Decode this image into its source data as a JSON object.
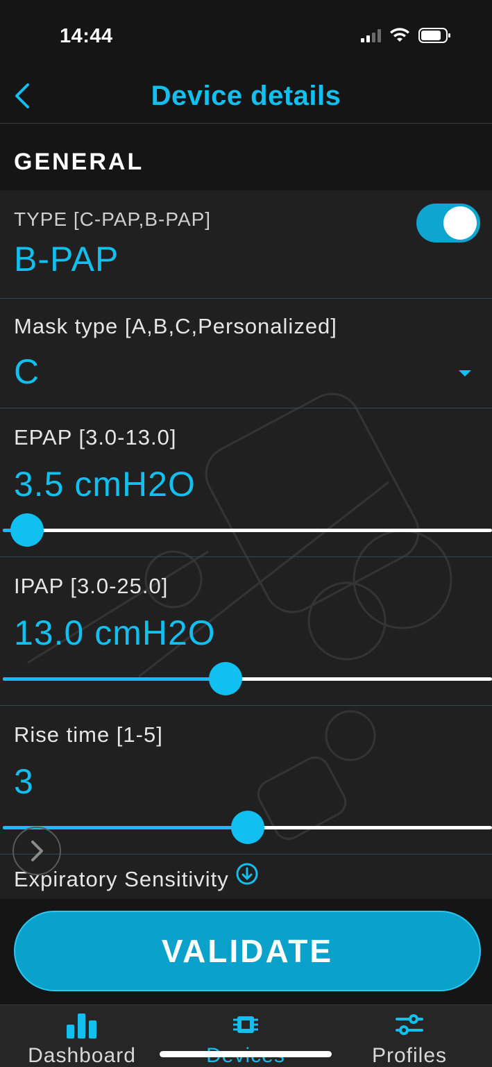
{
  "status": {
    "time": "14:44"
  },
  "header": {
    "title": "Device details"
  },
  "section": {
    "title": "GENERAL"
  },
  "fields": {
    "type": {
      "label": "TYPE [C-PAP,B-PAP]",
      "value": "B-PAP",
      "toggle_on": true
    },
    "mask": {
      "label": "Mask type [A,B,C,Personalized]",
      "value": "C"
    },
    "epap": {
      "label": "EPAP [3.0-13.0]",
      "value": "3.5 cmH2O",
      "slider_fraction": 0.05
    },
    "ipap": {
      "label": "IPAP [3.0-25.0]",
      "value": "13.0 cmH2O",
      "slider_fraction": 0.455
    },
    "rise_time": {
      "label": "Rise time [1-5]",
      "value": "3",
      "slider_fraction": 0.5
    },
    "expiratory": {
      "label": "Expiratory Sensitivity"
    }
  },
  "validate_label": "VALIDATE",
  "tabs": [
    {
      "label": "Dashboard",
      "icon": "bar-chart-icon",
      "active": false
    },
    {
      "label": "Devices",
      "icon": "chip-icon",
      "active": true
    },
    {
      "label": "Profiles",
      "icon": "sliders-icon",
      "active": false
    }
  ],
  "colors": {
    "accent": "#12bfee",
    "background": "#151515",
    "panel": "#202020",
    "button": "#0aa2cb"
  }
}
